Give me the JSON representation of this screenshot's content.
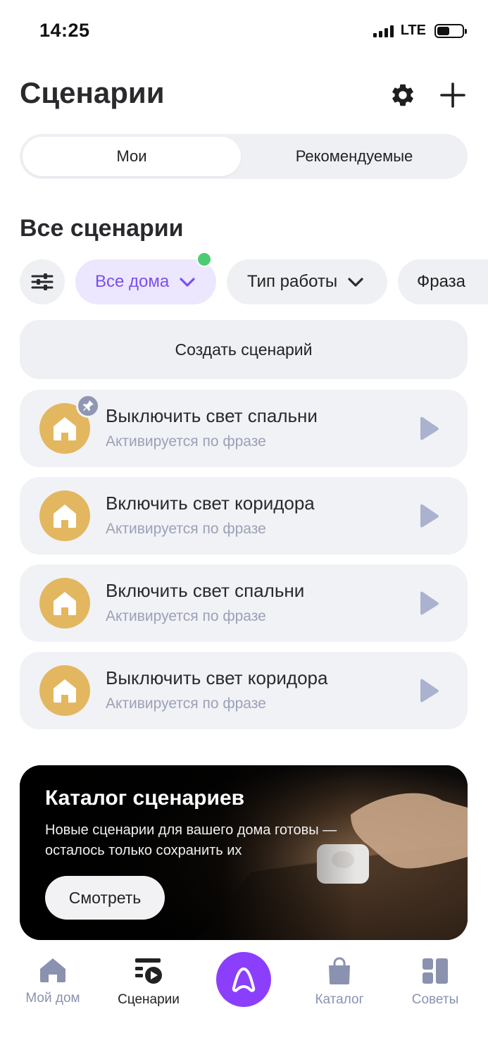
{
  "status_bar": {
    "time": "14:25",
    "network": "LTE"
  },
  "header": {
    "title": "Сценарии"
  },
  "tabs": [
    {
      "label": "Мои",
      "active": true
    },
    {
      "label": "Рекомендуемые",
      "active": false
    }
  ],
  "section": {
    "title": "Все сценарии"
  },
  "filters": {
    "chips": [
      {
        "label": "Все дома",
        "active": true
      },
      {
        "label": "Тип работы",
        "active": false
      },
      {
        "label": "Фраза",
        "active": false
      }
    ]
  },
  "create_button": {
    "label": "Создать сценарий"
  },
  "scenarios": [
    {
      "name": "Выключить свет спальни",
      "subtitle": "Активируется по фразе",
      "pinned": true
    },
    {
      "name": "Включить свет коридора",
      "subtitle": "Активируется по фразе",
      "pinned": false
    },
    {
      "name": "Включить свет спальни",
      "subtitle": "Активируется по фразе",
      "pinned": false
    },
    {
      "name": "Выключить свет коридора",
      "subtitle": "Активируется по фразе",
      "pinned": false
    }
  ],
  "banner": {
    "title": "Каталог сценариев",
    "description": "Новые сценарии для вашего дома готовы — осталось только сохранить их",
    "button_label": "Смотреть"
  },
  "bottom_nav": [
    {
      "label": "Мой дом",
      "icon": "house-icon",
      "active": false
    },
    {
      "label": "Сценарии",
      "icon": "scenarios-icon",
      "active": true
    },
    {
      "label": "",
      "icon": "alice-icon",
      "active": false
    },
    {
      "label": "Каталог",
      "icon": "shopping-bag-icon",
      "active": false
    },
    {
      "label": "Советы",
      "icon": "tips-grid-icon",
      "active": false
    }
  ],
  "colors": {
    "accent": "#7b4ff0",
    "alice": "#8b3ffd",
    "avatar": "#e3b760",
    "chip_bg": "#eff0f4",
    "badge": "#4ccc72",
    "muted_text": "#9ba1b8"
  }
}
